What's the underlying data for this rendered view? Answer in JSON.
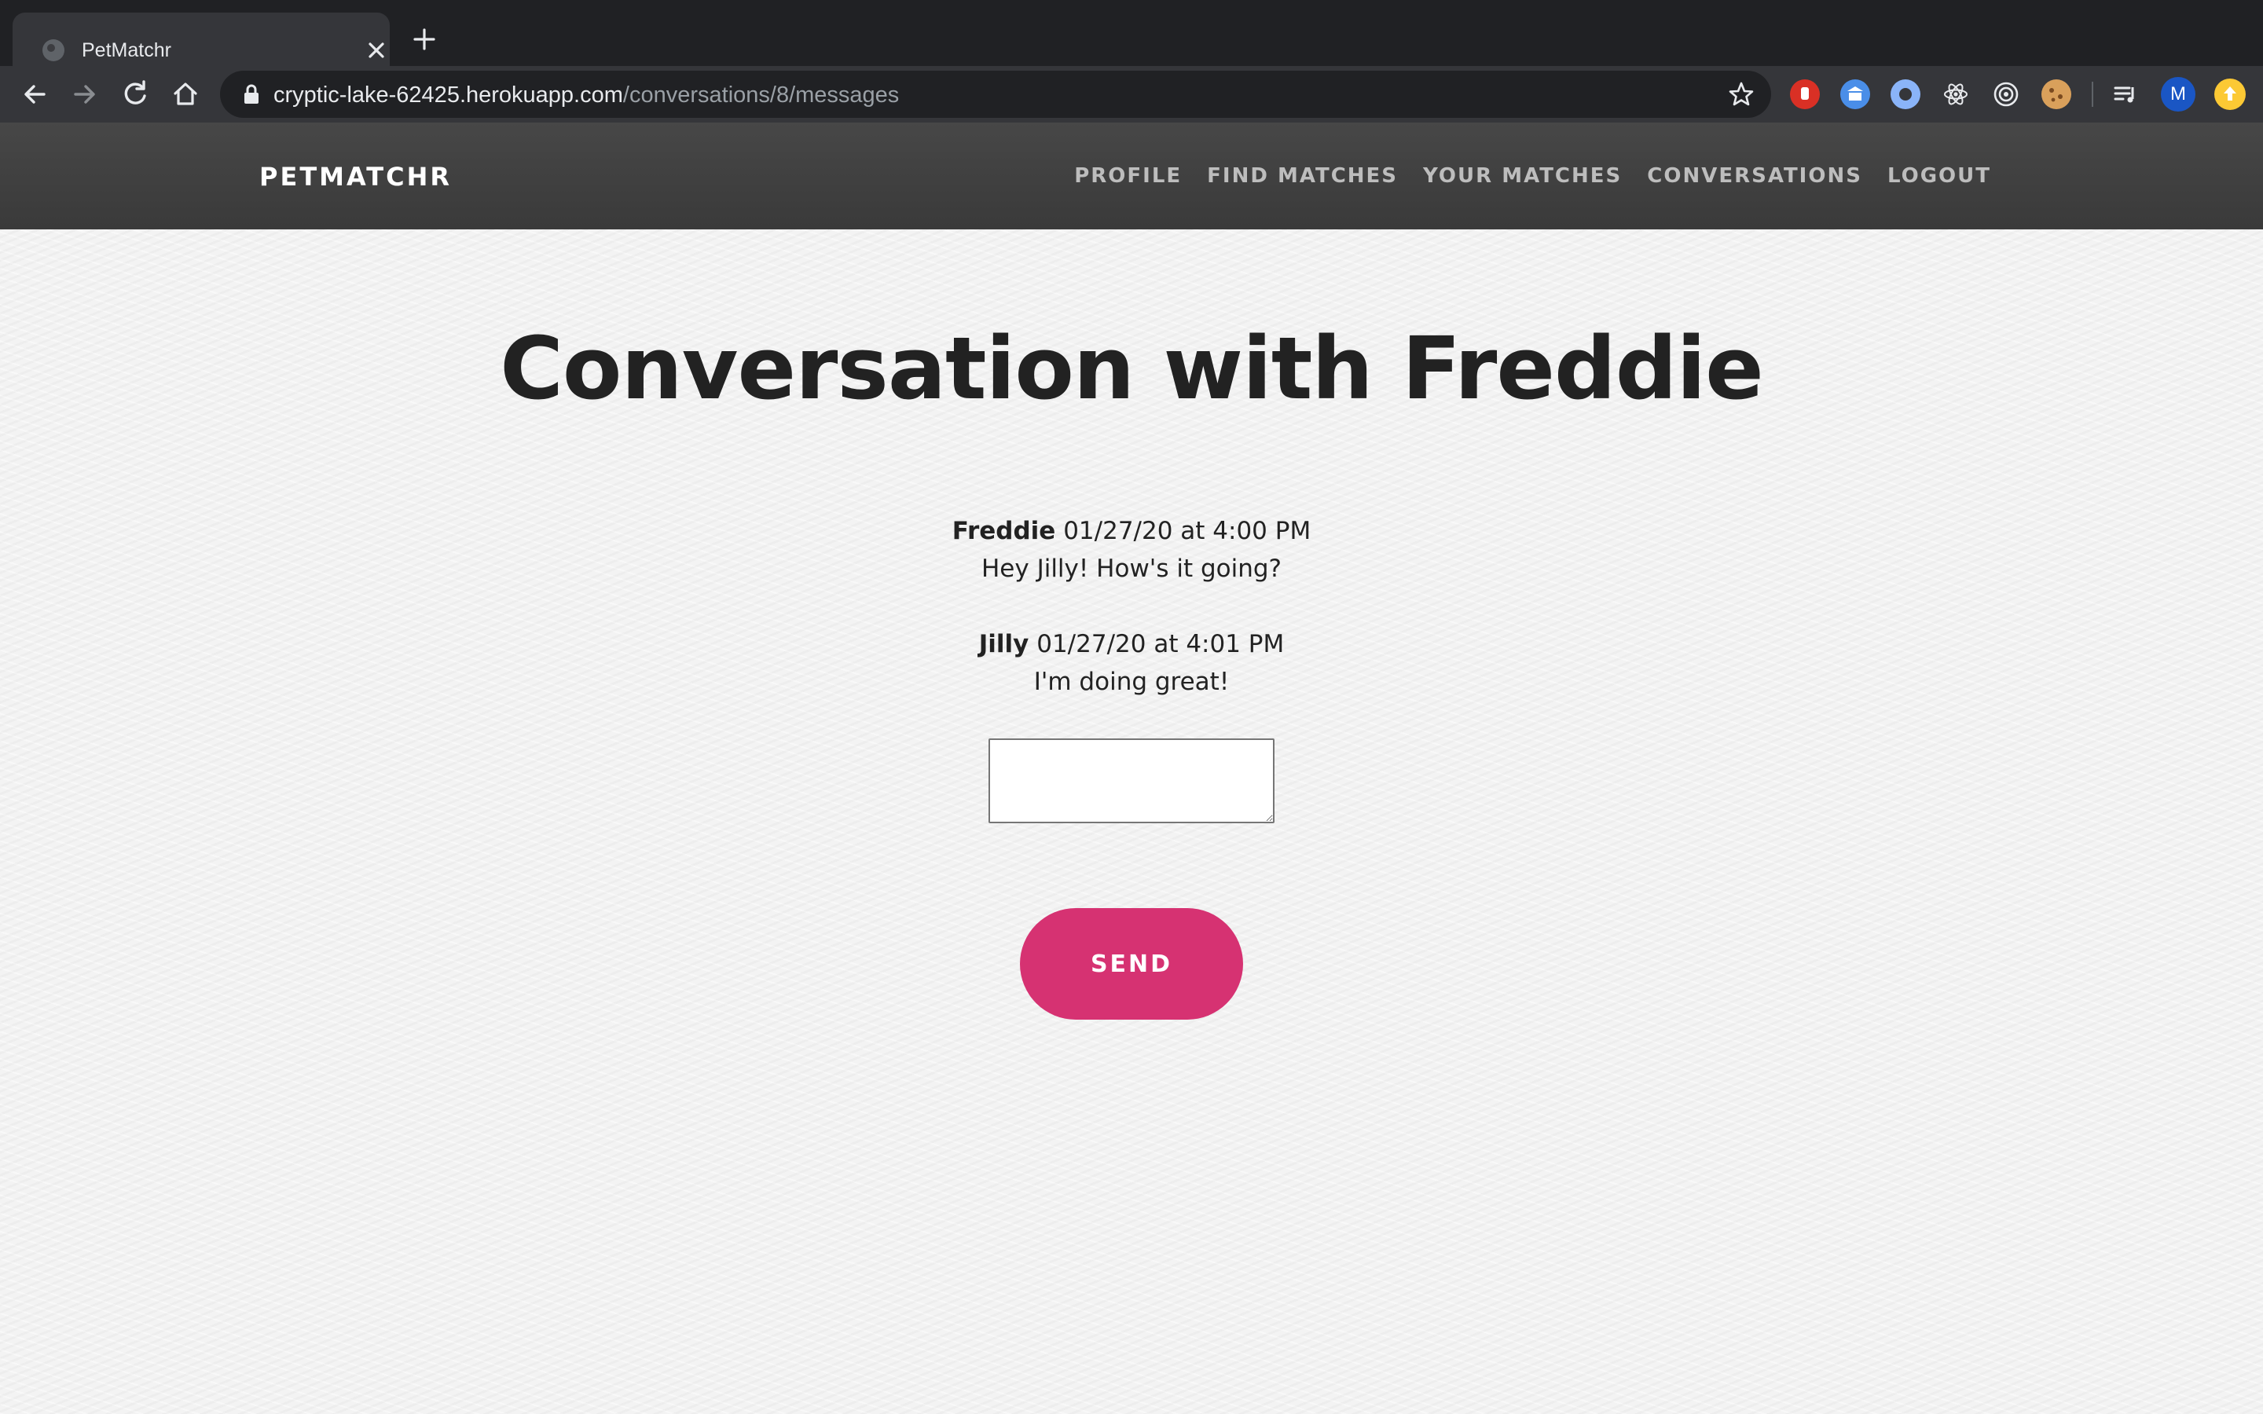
{
  "browser": {
    "tab_title": "PetMatchr",
    "url_host": "cryptic-lake-62425.herokuapp.com",
    "url_path": "/conversations/8/messages",
    "profile_initial": "M",
    "extensions": [
      "adblock-icon",
      "bank-icon",
      "blue-circle-icon",
      "react-devtools-icon",
      "target-icon",
      "cookie-icon"
    ],
    "colors": {
      "tabstrip": "#202124",
      "toolbar": "#35363a"
    }
  },
  "nav": {
    "brand": "PETMATCHR",
    "links": [
      {
        "label": "PROFILE"
      },
      {
        "label": "FIND MATCHES"
      },
      {
        "label": "YOUR MATCHES"
      },
      {
        "label": "CONVERSATIONS"
      },
      {
        "label": "LOGOUT"
      }
    ],
    "colors": {
      "bar": "#424242",
      "link": "#bdbdbd"
    }
  },
  "page": {
    "title": "Conversation with Freddie",
    "messages": [
      {
        "sender": "Freddie",
        "timestamp": "01/27/20 at 4:00 PM",
        "text": "Hey Jilly! How's it going?"
      },
      {
        "sender": "Jilly",
        "timestamp": "01/27/20 at 4:01 PM",
        "text": "I'm doing great!"
      }
    ],
    "reply_value": "",
    "send_label": "SEND",
    "colors": {
      "accent": "#d63272"
    }
  }
}
